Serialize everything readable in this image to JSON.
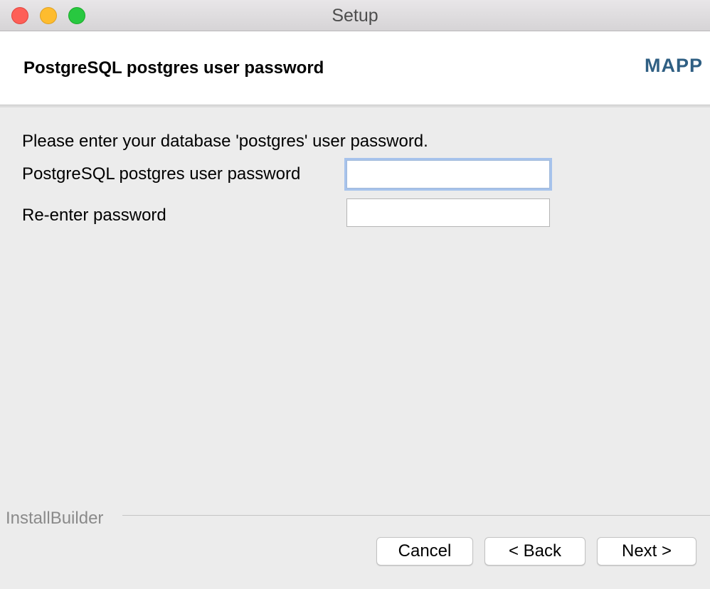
{
  "window": {
    "title": "Setup"
  },
  "header": {
    "title": "PostgreSQL postgres user password",
    "logo_text": "MAPP"
  },
  "main": {
    "instruction": "Please enter your database 'postgres' user password.",
    "password_label": "PostgreSQL postgres user password",
    "password_value": "",
    "reenter_label": "Re-enter password",
    "reenter_value": ""
  },
  "footer": {
    "brand": "InstallBuilder",
    "cancel_label": "Cancel",
    "back_label": "< Back",
    "next_label": "Next >"
  },
  "colors": {
    "logo": "#2f5f83",
    "close": "#fe5f57",
    "minimize": "#febc2e",
    "maximize": "#28c840",
    "focus_ring": "#a7c3ec"
  }
}
